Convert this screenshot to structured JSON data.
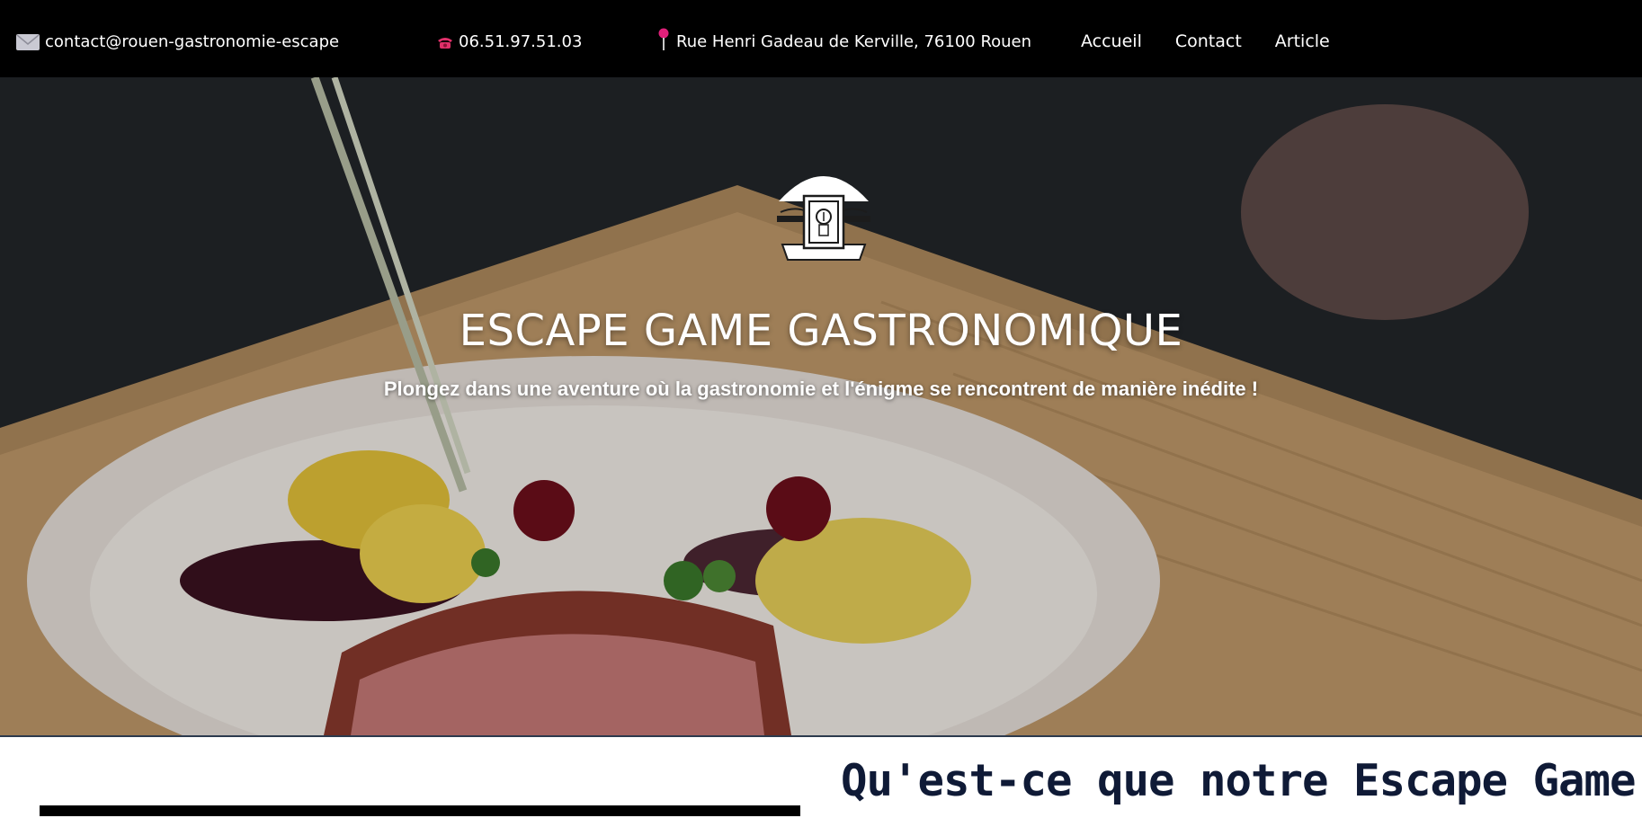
{
  "topbar": {
    "email": "contact@rouen-gastronomie-escape",
    "phone": "06.51.97.51.03",
    "address": "Rue Henri Gadeau de Kerville, 76100 Rouen",
    "icons": {
      "email": "mail-icon",
      "phone": "phone-icon",
      "address": "map-pin-icon"
    }
  },
  "nav": {
    "items": [
      {
        "label": "Accueil"
      },
      {
        "label": "Contact"
      },
      {
        "label": "Article"
      }
    ]
  },
  "hero": {
    "title": "ESCAPE GAME GASTRONOMIQUE",
    "subtitle": "Plongez dans une aventure où la gastronomie et l'énigme se rencontrent de manière inédite !",
    "logo_icon": "cloche-keyhole-logo"
  },
  "section": {
    "heading": "Qu'est-ce que notre Escape Game"
  },
  "colors": {
    "topbar_bg": "#000000",
    "heading_color": "#0f1a36",
    "pin_color": "#e0207a",
    "phone_color": "#e0306a"
  }
}
